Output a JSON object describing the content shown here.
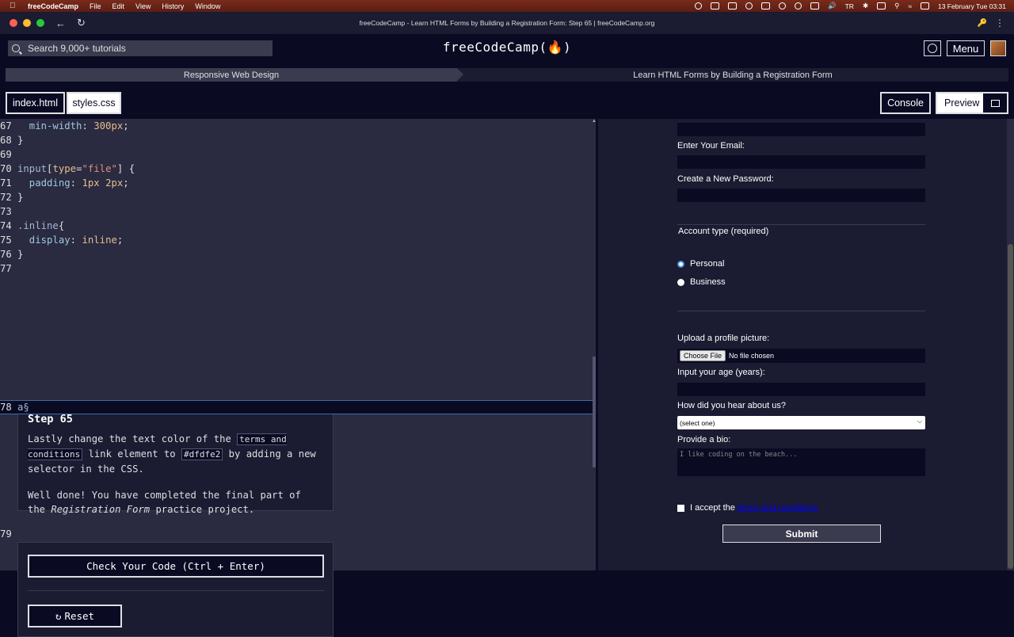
{
  "menubar": {
    "app": "freeCodeCamp",
    "items": [
      "File",
      "Edit",
      "View",
      "History",
      "Window"
    ],
    "input_source": "TR",
    "datetime": "13 February Tue  03:31"
  },
  "window": {
    "title": "freeCodeCamp - Learn HTML Forms by Building a Registration Form: Step 65 | freeCodeCamp.org"
  },
  "nav": {
    "search_placeholder": "Search 9,000+ tutorials",
    "brand": "freeCodeCamp(🔥)",
    "menu_label": "Menu"
  },
  "breadcrumb": {
    "superblock": "Responsive Web Design",
    "block": "Learn HTML Forms by Building a Registration Form"
  },
  "tabs": {
    "files": [
      "index.html",
      "styles.css"
    ],
    "console": "Console",
    "preview": "Preview"
  },
  "editor": {
    "lines": [
      {
        "n": "67",
        "parts": [
          {
            "t": "  min-width",
            "c": "prop"
          },
          {
            "t": ": ",
            "c": "br"
          },
          {
            "t": "300px",
            "c": "val"
          },
          {
            "t": ";",
            "c": "br"
          }
        ]
      },
      {
        "n": "68",
        "parts": [
          {
            "t": "}",
            "c": "br"
          }
        ]
      },
      {
        "n": "69",
        "parts": []
      },
      {
        "n": "70",
        "parts": [
          {
            "t": "input",
            "c": "sel"
          },
          {
            "t": "[",
            "c": "br"
          },
          {
            "t": "type",
            "c": "val"
          },
          {
            "t": "=",
            "c": "br"
          },
          {
            "t": "\"file\"",
            "c": "str"
          },
          {
            "t": "] {",
            "c": "br"
          }
        ]
      },
      {
        "n": "71",
        "parts": [
          {
            "t": "  padding",
            "c": "prop"
          },
          {
            "t": ": ",
            "c": "br"
          },
          {
            "t": "1px 2px",
            "c": "val"
          },
          {
            "t": ";",
            "c": "br"
          }
        ]
      },
      {
        "n": "72",
        "parts": [
          {
            "t": "}",
            "c": "br"
          }
        ]
      },
      {
        "n": "73",
        "parts": []
      },
      {
        "n": "74",
        "parts": [
          {
            "t": ".inline",
            "c": "sel"
          },
          {
            "t": "{",
            "c": "br"
          }
        ]
      },
      {
        "n": "75",
        "parts": [
          {
            "t": "  display",
            "c": "prop"
          },
          {
            "t": ": ",
            "c": "br"
          },
          {
            "t": "inline",
            "c": "val"
          },
          {
            "t": ";",
            "c": "br"
          }
        ]
      },
      {
        "n": "76",
        "parts": [
          {
            "t": "}",
            "c": "br"
          }
        ]
      },
      {
        "n": "77",
        "parts": []
      }
    ],
    "active_line": {
      "n": "78",
      "text": "a§"
    },
    "last_line": {
      "n": "79",
      "text": ""
    }
  },
  "step": {
    "title": "Step 65",
    "p1_before": "Lastly change the text color of the ",
    "p1_code1": "terms and conditions",
    "p1_mid": " link element to ",
    "p1_code2": "#dfdfe2",
    "p1_after": " by adding a new selector in the CSS.",
    "p2_before": "Well done! You have completed the final part of the ",
    "p2_em": "Registration Form",
    "p2_after": " practice project."
  },
  "actions": {
    "check": "Check Your Code (Ctrl + Enter)",
    "reset": "Reset"
  },
  "preview": {
    "email_label": "Enter Your Email:",
    "password_label": "Create a New Password:",
    "account_legend": "Account type (required)",
    "radio_personal": "Personal",
    "radio_business": "Business",
    "upload_label": "Upload a profile picture:",
    "file_button": "Choose File",
    "file_status": "No file chosen",
    "age_label": "Input your age (years):",
    "referrer_label": "How did you hear about us?",
    "referrer_value": "(select one)",
    "bio_label": "Provide a bio:",
    "bio_placeholder": "I like coding on the beach...",
    "terms_text": "I accept the",
    "terms_link": "terms and conditions",
    "submit": "Submit"
  },
  "colors": {
    "bg": "#0a0a23",
    "panel": "#1b1b32",
    "editor": "#2a2a40",
    "accent_link": "#0000ee"
  }
}
